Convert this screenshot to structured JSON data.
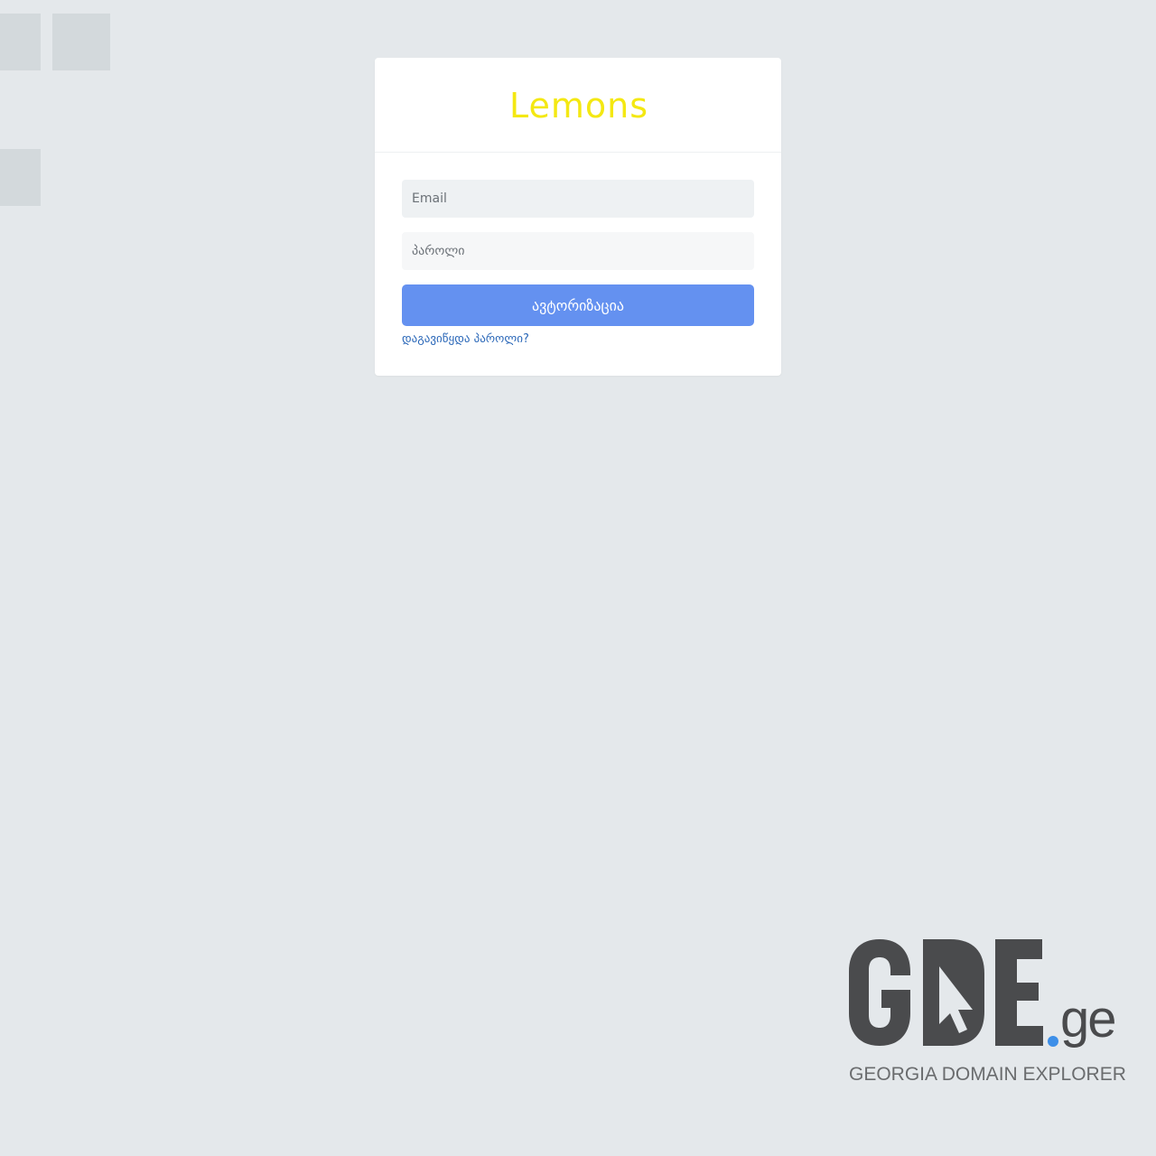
{
  "brand": {
    "name": "Lemons",
    "color": "#f4e812"
  },
  "login_form": {
    "email_placeholder": "Email",
    "password_placeholder": "პაროლი",
    "submit_label": "ავტორიზაცია",
    "forgot_password_label": "დაგავიწყდა პაროლი?",
    "accent_color": "#6491f0"
  },
  "watermark": {
    "logo_text": "GDE.ge",
    "tagline": "GEORGIA DOMAIN EXPLORER"
  }
}
